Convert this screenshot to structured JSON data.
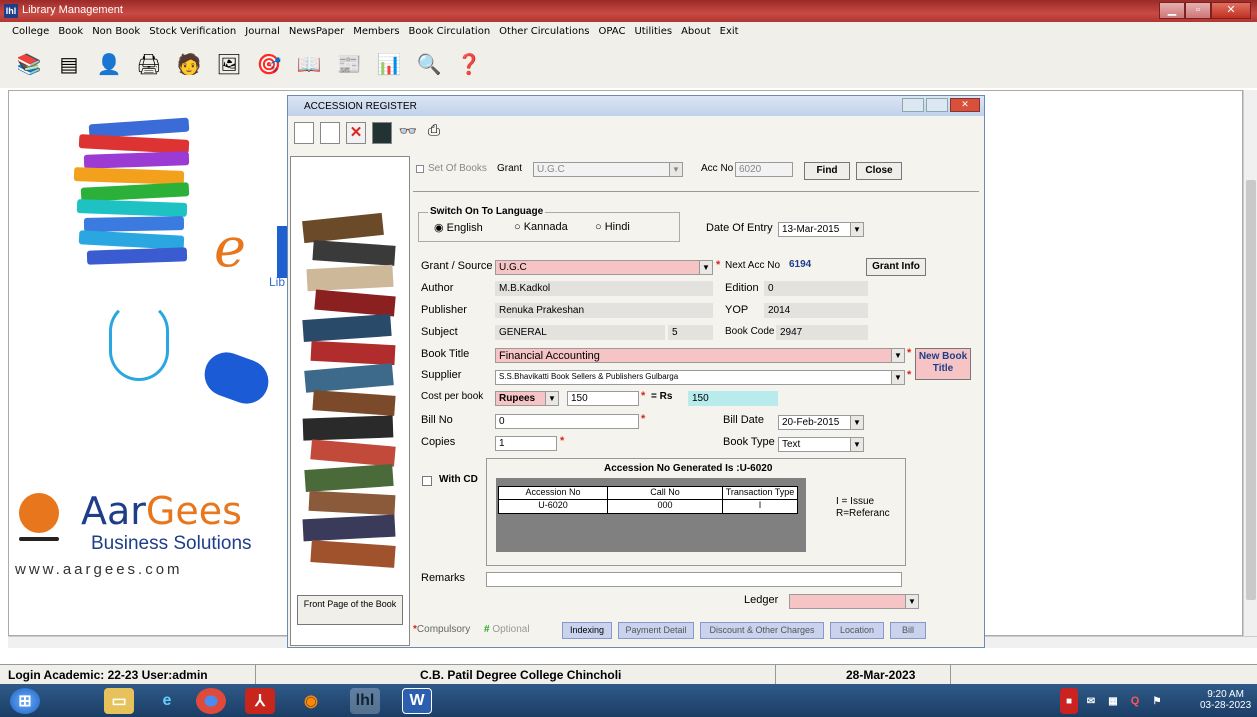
{
  "app": {
    "title": "Library Management"
  },
  "menu": [
    "College",
    "Book",
    "Non Book",
    "Stock Verification",
    "Journal",
    "NewsPaper",
    "Members",
    "Book Circulation",
    "Other Circulations",
    "OPAC",
    "Utilities",
    "About",
    "Exit"
  ],
  "brand": {
    "logo_partial": "e",
    "company_first": "Aar",
    "company_second": "Gees",
    "company_sub": "Business Solutions",
    "website": "www.aargees.com",
    "lib_partial": "Lib"
  },
  "dialog": {
    "title": "ACCESSION REGISTER",
    "set_of_books": "Set Of Books",
    "grant_label": "Grant",
    "grant_value": "U.G.C",
    "acc_no_label": "Acc No",
    "acc_no_value": "6020",
    "find": "Find",
    "close": "Close",
    "lang_legend": "Switch On To Language",
    "lang_english": "English",
    "lang_kannada": "Kannada",
    "lang_hindi": "Hindi",
    "date_entry_label": "Date Of Entry",
    "date_entry_value": "13-Mar-2015",
    "grant_source_label": "Grant / Source",
    "grant_source_value": "U.G.C",
    "next_acc_label": "Next Acc No",
    "next_acc_value": "6194",
    "grant_info": "Grant Info",
    "author_label": "Author",
    "author_value": "M.B.Kadkol",
    "edition_label": "Edition",
    "edition_value": "0",
    "publisher_label": "Publisher",
    "publisher_value": "Renuka Prakeshan",
    "yop_label": "YOP",
    "yop_value": "2014",
    "subject_label": "Subject",
    "subject_value": "GENERAL",
    "subject_num": "5",
    "book_code_label": "Book Code",
    "book_code_value": "2947",
    "book_title_label": "Book Title",
    "book_title_value": "Financial Accounting",
    "new_book_title": "New Book Title",
    "supplier_label": "Supplier",
    "supplier_value": "S.S.Bhavikatti Book Sellers & Publishers Gulbarga",
    "cost_label": "Cost per book",
    "currency": "Rupees",
    "cost_value": "150",
    "rs_label": "= Rs",
    "rs_value": "150",
    "bill_no_label": "Bill No",
    "bill_no_value": "0",
    "bill_date_label": "Bill Date",
    "bill_date_value": "20-Feb-2015",
    "copies_label": "Copies",
    "copies_value": "1",
    "book_type_label": "Book Type",
    "book_type_value": "Text",
    "with_cd": "With CD",
    "acc_generated": "Accession No Generated Is :U-6020",
    "table_headers": [
      "Accession No",
      "Call No",
      "Transaction Type"
    ],
    "table_rows": [
      [
        "U-6020",
        "000",
        "I"
      ]
    ],
    "legend_issue": "I = Issue",
    "legend_ref": "R=Referanc",
    "remarks_label": "Remarks",
    "ledger_label": "Ledger",
    "front_page": "Front Page of the Book",
    "compulsory": "Compulsory",
    "optional": "Optional",
    "bottom_buttons": [
      "Indexing",
      "Payment Detail",
      "Discount & Other Charges",
      "Location",
      "Bill"
    ]
  },
  "status": {
    "login": "Login Academic: 22-23  User:admin",
    "college": "C.B. Patil Degree College Chincholi",
    "date": "28-Mar-2023"
  },
  "clock": {
    "time": "9:20 AM",
    "date": "03-28-2023"
  },
  "colors": {
    "title_bar": "#b33a36",
    "pink_field": "#f6c4c4",
    "orange": "#e8761c",
    "blue_text": "#1f3e8a"
  }
}
